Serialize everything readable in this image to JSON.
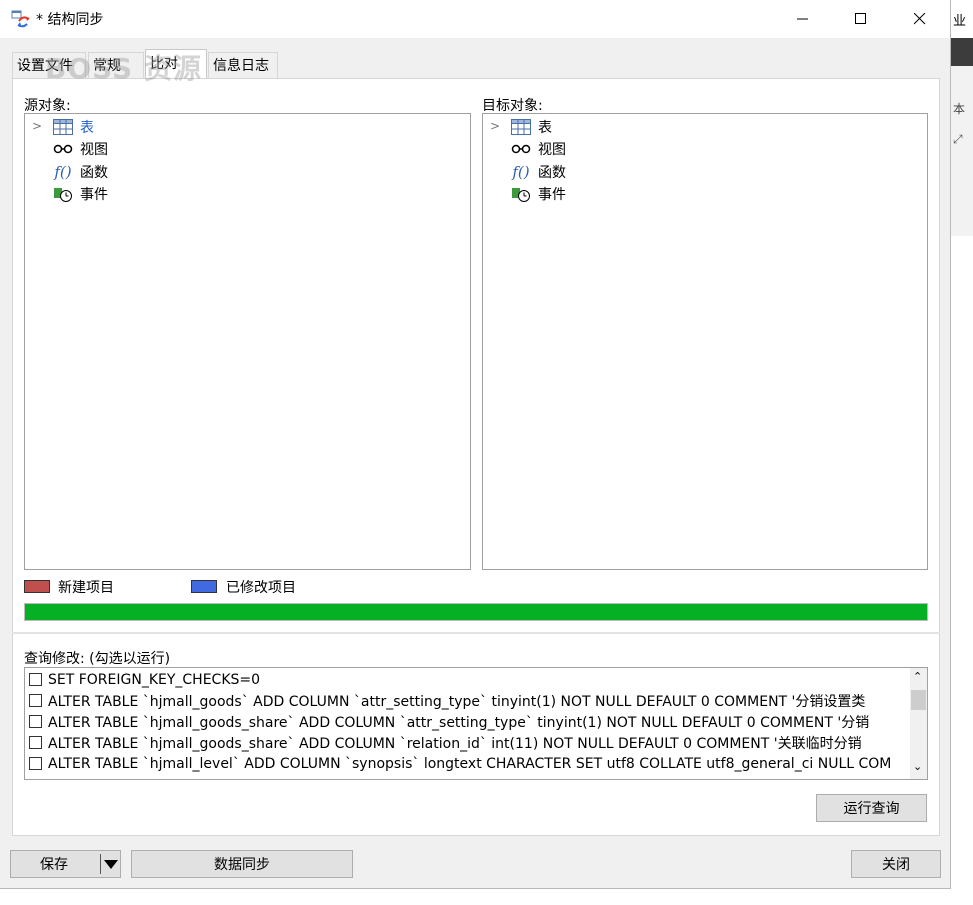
{
  "window": {
    "title": "* 结构同步",
    "controls": [
      "minimize",
      "maximize",
      "close"
    ]
  },
  "background_app": {
    "text1": "业",
    "text2": "本"
  },
  "watermark": "BOSS 资源",
  "tabs": [
    {
      "label": "设置文件",
      "active": false
    },
    {
      "label": "常规",
      "active": false
    },
    {
      "label": "比对",
      "active": true
    },
    {
      "label": "信息日志",
      "active": false
    }
  ],
  "source": {
    "label": "源对象:",
    "items": [
      {
        "label": "表",
        "icon": "table-icon",
        "selected": true
      },
      {
        "label": "视图",
        "icon": "view-icon"
      },
      {
        "label": "函数",
        "icon": "function-icon"
      },
      {
        "label": "事件",
        "icon": "event-icon"
      }
    ]
  },
  "target": {
    "label": "目标对象:",
    "items": [
      {
        "label": "表",
        "icon": "table-icon"
      },
      {
        "label": "视图",
        "icon": "view-icon"
      },
      {
        "label": "函数",
        "icon": "function-icon"
      },
      {
        "label": "事件",
        "icon": "event-icon"
      }
    ]
  },
  "legend": {
    "new_label": "新建项目",
    "new_color": "#c0504d",
    "modified_label": "已修改项目",
    "modified_color": "#4169e1"
  },
  "progress": {
    "percent": 100,
    "color": "#06b025"
  },
  "query": {
    "label": "查询修改: (勾选以运行)",
    "rows": [
      "SET FOREIGN_KEY_CHECKS=0",
      "ALTER TABLE `hjmall_goods` ADD COLUMN `attr_setting_type`  tinyint(1) NOT NULL DEFAULT 0 COMMENT '分销设置类",
      "ALTER TABLE `hjmall_goods_share` ADD COLUMN `attr_setting_type`  tinyint(1) NOT NULL DEFAULT 0 COMMENT '分销",
      "ALTER TABLE `hjmall_goods_share` ADD COLUMN `relation_id`  int(11) NOT NULL DEFAULT 0 COMMENT '关联临时分销",
      "ALTER TABLE `hjmall_level` ADD COLUMN `synopsis`  longtext CHARACTER SET utf8 COLLATE utf8_general_ci NULL COM"
    ],
    "run_button": "运行查询"
  },
  "footer": {
    "save_button": "保存",
    "sync_button": "数据同步",
    "close_button": "关闭"
  }
}
